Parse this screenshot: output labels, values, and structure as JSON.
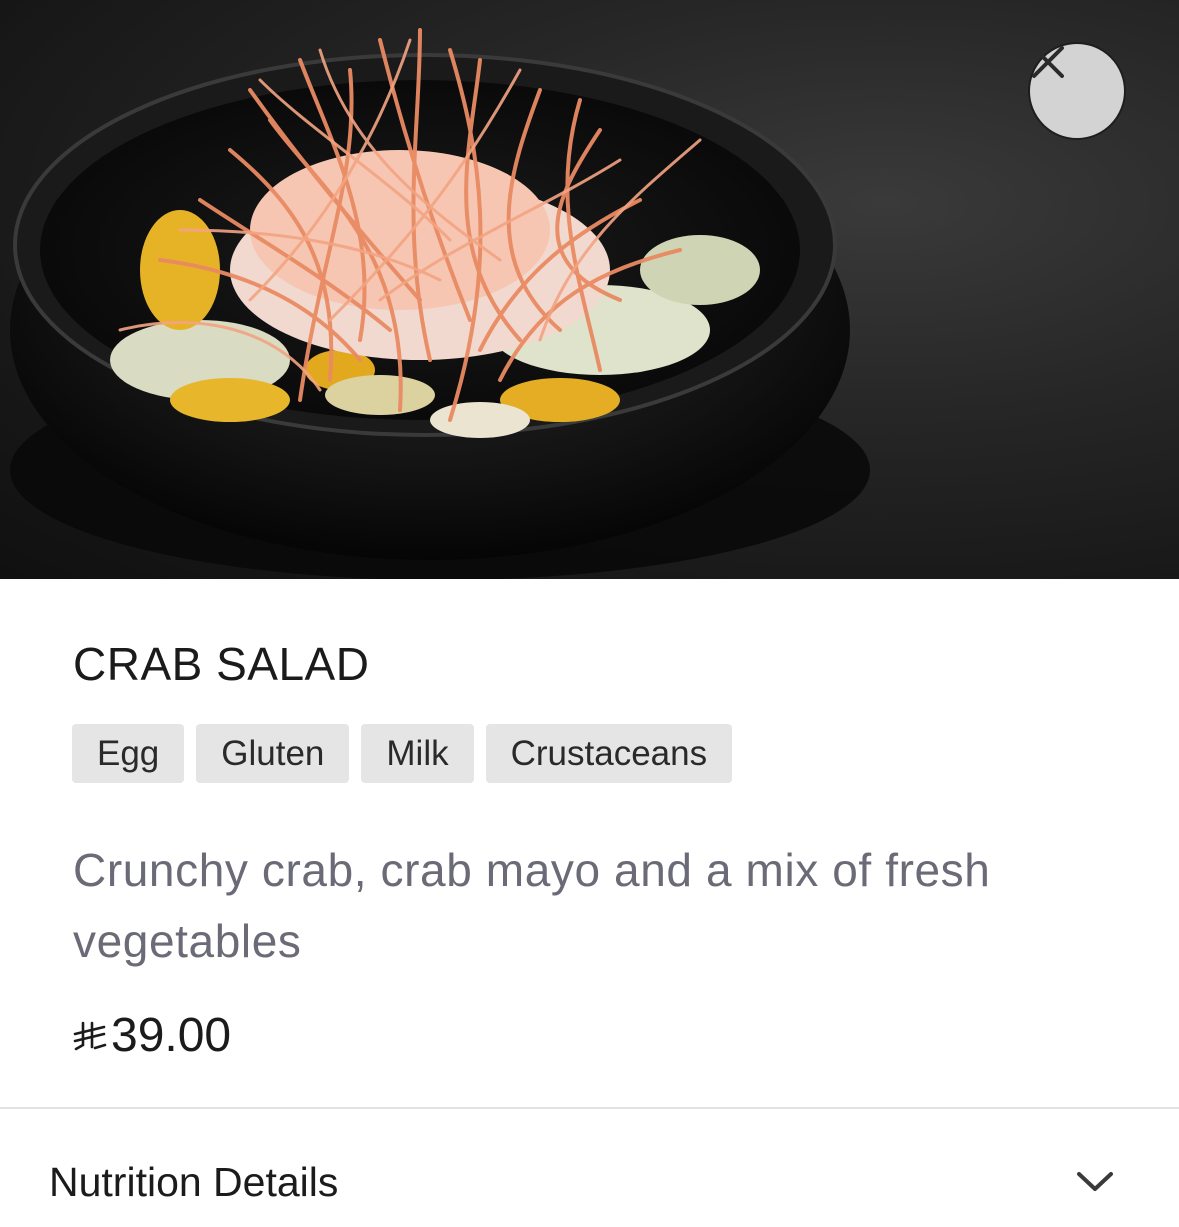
{
  "item": {
    "title": "CRAB SALAD",
    "allergens": [
      "Egg",
      "Gluten",
      "Milk",
      "Crustaceans"
    ],
    "description": "Crunchy crab, crab mayo and a mix of fresh vegetables",
    "price": "39.00",
    "currency_icon": "saudi-riyal-symbol"
  },
  "nutrition": {
    "label": "Nutrition Details"
  },
  "icons": {
    "close": "close-icon",
    "expand": "chevron-down-icon"
  },
  "colors": {
    "tag_background": "#e5e5e5",
    "description_text": "#6b6b78",
    "close_button": "#d3d3d3"
  }
}
